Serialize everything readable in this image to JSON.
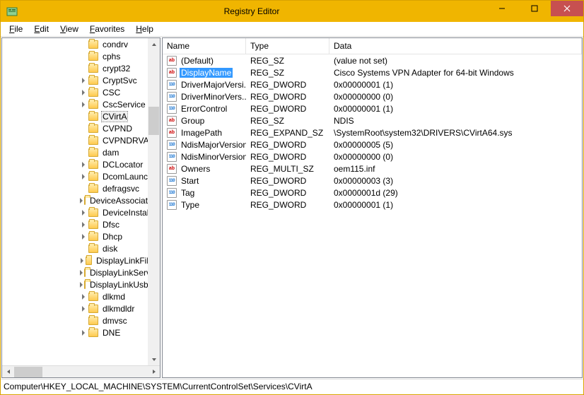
{
  "window": {
    "title": "Registry Editor"
  },
  "menu": {
    "file": "File",
    "edit": "Edit",
    "view": "View",
    "favorites": "Favorites",
    "help": "Help"
  },
  "tree": {
    "items": [
      {
        "label": "condrv",
        "expander": false
      },
      {
        "label": "cphs",
        "expander": false
      },
      {
        "label": "crypt32",
        "expander": false
      },
      {
        "label": "CryptSvc",
        "expander": true
      },
      {
        "label": "CSC",
        "expander": true
      },
      {
        "label": "CscService",
        "expander": true
      },
      {
        "label": "CVirtA",
        "expander": false,
        "selected": true
      },
      {
        "label": "CVPND",
        "expander": false
      },
      {
        "label": "CVPNDRVA",
        "expander": false
      },
      {
        "label": "dam",
        "expander": false
      },
      {
        "label": "DCLocator",
        "expander": true
      },
      {
        "label": "DcomLaunch",
        "expander": true
      },
      {
        "label": "defragsvc",
        "expander": false
      },
      {
        "label": "DeviceAssociationService",
        "expander": true
      },
      {
        "label": "DeviceInstall",
        "expander": true
      },
      {
        "label": "Dfsc",
        "expander": true
      },
      {
        "label": "Dhcp",
        "expander": true
      },
      {
        "label": "disk",
        "expander": false
      },
      {
        "label": "DisplayLinkFilter",
        "expander": true
      },
      {
        "label": "DisplayLinkService",
        "expander": true
      },
      {
        "label": "DisplayLinkUsbPort",
        "expander": true
      },
      {
        "label": "dlkmd",
        "expander": true
      },
      {
        "label": "dlkmdldr",
        "expander": true
      },
      {
        "label": "dmvsc",
        "expander": false
      },
      {
        "label": "DNE",
        "expander": true
      }
    ]
  },
  "list": {
    "columns": {
      "name": "Name",
      "type": "Type",
      "data": "Data"
    },
    "rows": [
      {
        "icon": "sz",
        "name": "(Default)",
        "type": "REG_SZ",
        "data": "(value not set)",
        "selected": false
      },
      {
        "icon": "sz",
        "name": "DisplayName",
        "type": "REG_SZ",
        "data": "Cisco Systems VPN Adapter for 64-bit Windows",
        "selected": true
      },
      {
        "icon": "bin",
        "name": "DriverMajorVersi...",
        "type": "REG_DWORD",
        "data": "0x00000001 (1)",
        "selected": false
      },
      {
        "icon": "bin",
        "name": "DriverMinorVers...",
        "type": "REG_DWORD",
        "data": "0x00000000 (0)",
        "selected": false
      },
      {
        "icon": "bin",
        "name": "ErrorControl",
        "type": "REG_DWORD",
        "data": "0x00000001 (1)",
        "selected": false
      },
      {
        "icon": "sz",
        "name": "Group",
        "type": "REG_SZ",
        "data": "NDIS",
        "selected": false
      },
      {
        "icon": "sz",
        "name": "ImagePath",
        "type": "REG_EXPAND_SZ",
        "data": "\\SystemRoot\\system32\\DRIVERS\\CVirtA64.sys",
        "selected": false
      },
      {
        "icon": "bin",
        "name": "NdisMajorVersion",
        "type": "REG_DWORD",
        "data": "0x00000005 (5)",
        "selected": false
      },
      {
        "icon": "bin",
        "name": "NdisMinorVersion",
        "type": "REG_DWORD",
        "data": "0x00000000 (0)",
        "selected": false
      },
      {
        "icon": "sz",
        "name": "Owners",
        "type": "REG_MULTI_SZ",
        "data": "oem115.inf",
        "selected": false
      },
      {
        "icon": "bin",
        "name": "Start",
        "type": "REG_DWORD",
        "data": "0x00000003 (3)",
        "selected": false
      },
      {
        "icon": "bin",
        "name": "Tag",
        "type": "REG_DWORD",
        "data": "0x0000001d (29)",
        "selected": false
      },
      {
        "icon": "bin",
        "name": "Type",
        "type": "REG_DWORD",
        "data": "0x00000001 (1)",
        "selected": false
      }
    ]
  },
  "statusbar": {
    "path": "Computer\\HKEY_LOCAL_MACHINE\\SYSTEM\\CurrentControlSet\\Services\\CVirtA"
  }
}
